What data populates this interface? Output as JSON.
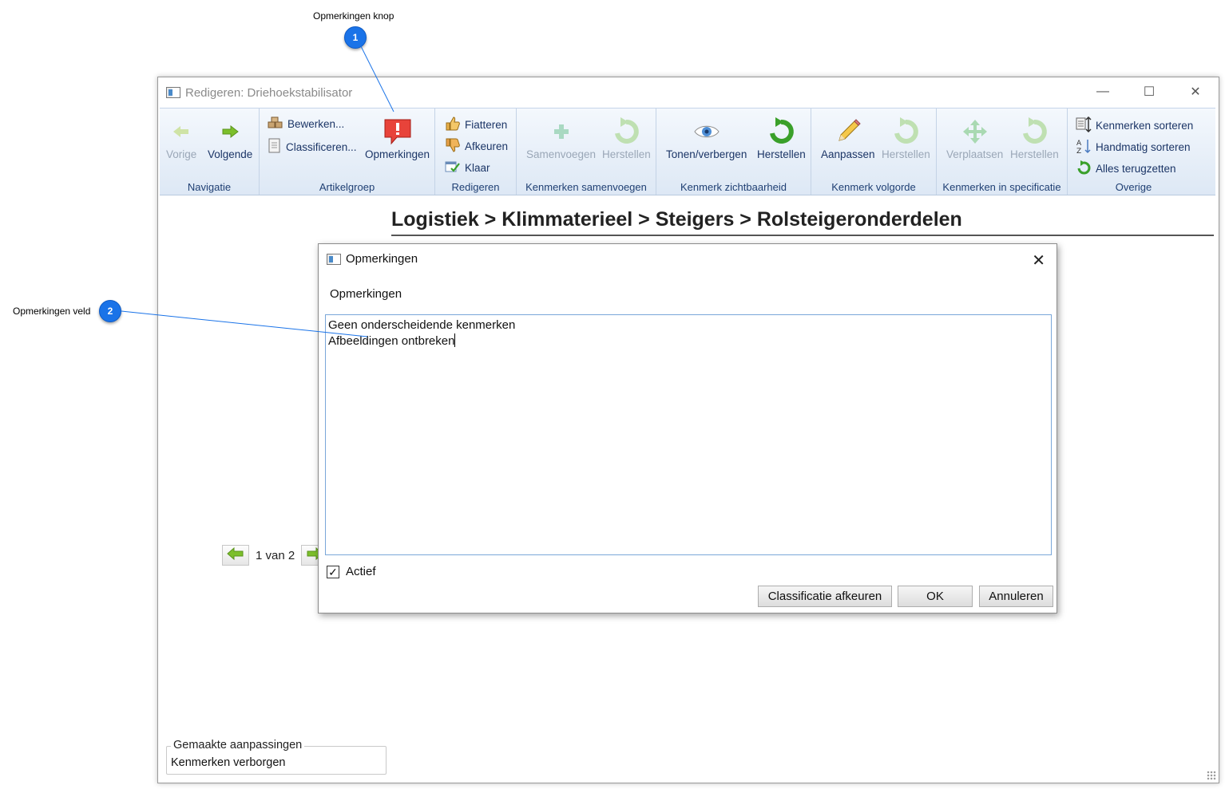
{
  "callouts": [
    {
      "number": "1",
      "label": "Opmerkingen knop"
    },
    {
      "number": "2",
      "label": "Opmerkingen veld"
    }
  ],
  "window": {
    "title": "Redigeren: Driehoekstabilisator"
  },
  "ribbon": {
    "navigatie": {
      "title": "Navigatie",
      "vorige": "Vorige",
      "volgende": "Volgende"
    },
    "artikelgroep": {
      "title": "Artikelgroep",
      "bewerken": "Bewerken...",
      "classificeren": "Classificeren...",
      "opmerkingen": "Opmerkingen"
    },
    "redigeren": {
      "title": "Redigeren",
      "fiatteren": "Fiatteren",
      "afkeuren": "Afkeuren",
      "klaar": "Klaar"
    },
    "samenvoegen": {
      "title": "Kenmerken samenvoegen",
      "samenvoegen": "Samenvoegen",
      "herstellen": "Herstellen"
    },
    "zichtbaarheid": {
      "title": "Kenmerk zichtbaarheid",
      "tonen": "Tonen/verbergen",
      "herstellen": "Herstellen"
    },
    "volgorde": {
      "title": "Kenmerk volgorde",
      "aanpassen": "Aanpassen",
      "herstellen": "Herstellen"
    },
    "specificatie": {
      "title": "Kenmerken in specificatie",
      "verplaatsen": "Verplaatsen",
      "herstellen": "Herstellen"
    },
    "overige": {
      "title": "Overige",
      "sorteren": "Kenmerken sorteren",
      "handmatig": "Handmatig sorteren",
      "terugzetten": "Alles terugzetten"
    }
  },
  "breadcrumb": "Logistiek > Klimmaterieel > Steigers > Rolsteigeronderdelen",
  "pager": {
    "text": "1 van 2"
  },
  "changes": {
    "legend": "Gemaakte aanpassingen",
    "value": "Kenmerken verborgen"
  },
  "dialog": {
    "title": "Opmerkingen",
    "field_label": "Opmerkingen",
    "line1": "Geen onderscheidende kenmerken",
    "line2": "Afbeeldingen ontbreken",
    "checkbox_label": "Actief",
    "btn_reject": "Classificatie afkeuren",
    "btn_ok": "OK",
    "btn_cancel": "Annuleren"
  }
}
